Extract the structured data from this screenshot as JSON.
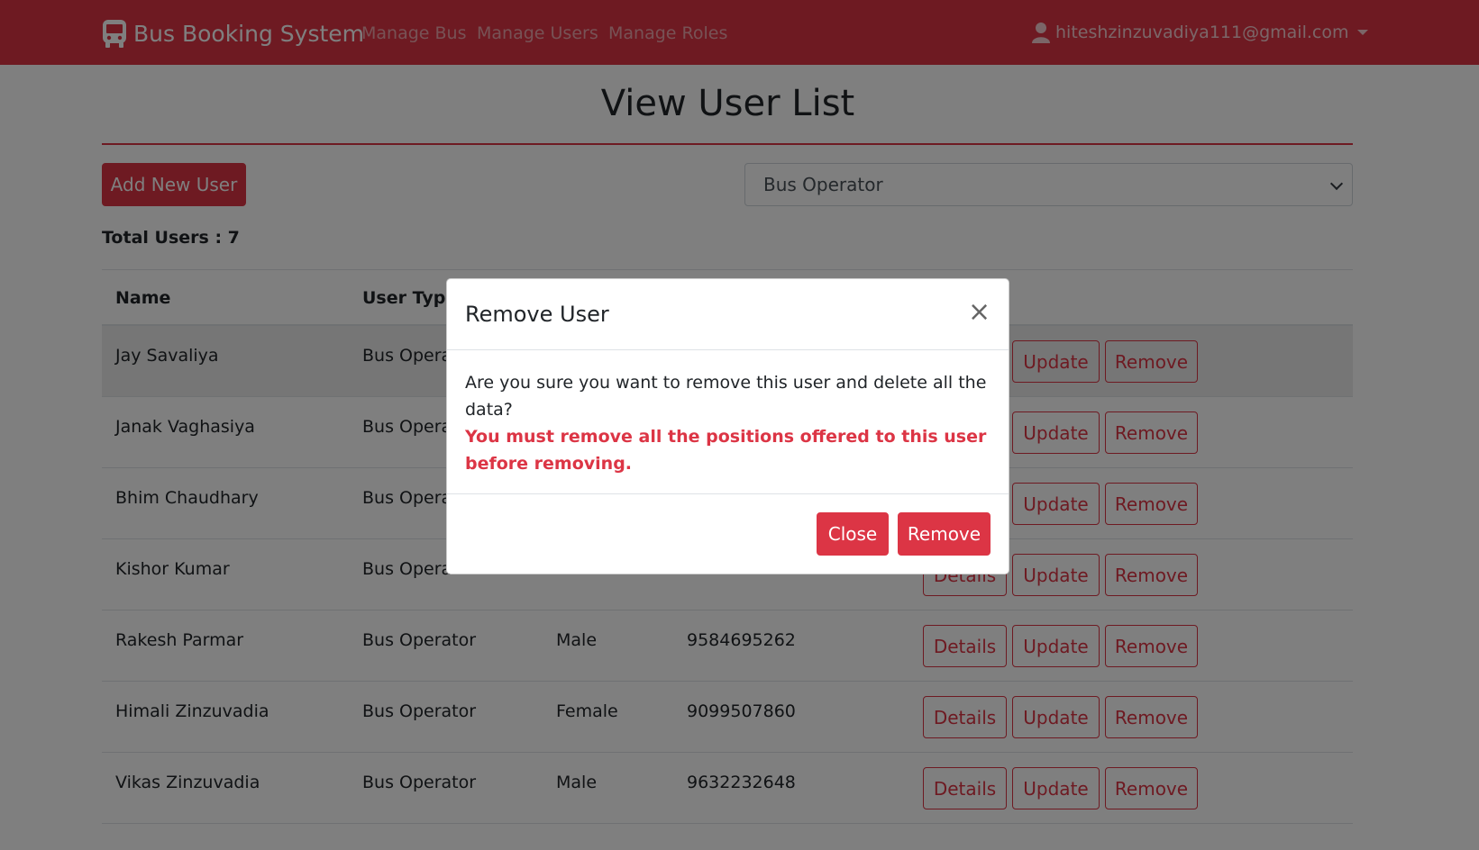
{
  "navbar": {
    "brand": "Bus Booking System",
    "links": [
      "Manage Bus",
      "Manage Users",
      "Manage Roles"
    ],
    "user_email": "hiteshzinzuvadiya111@gmail.com",
    "accent_color": "#dc3545"
  },
  "page": {
    "title": "View User List",
    "add_button": "Add New User",
    "role_select": {
      "selected": "Bus Operator"
    },
    "total_users": "Total Users : 7"
  },
  "table": {
    "headers": [
      "Name",
      "User Type"
    ],
    "rows": [
      {
        "name": "Jay Savaliya",
        "type": "Bus Operat",
        "gender": "",
        "phone": ""
      },
      {
        "name": "Janak Vaghasiya",
        "type": "Bus Operat",
        "gender": "",
        "phone": ""
      },
      {
        "name": "Bhim Chaudhary",
        "type": "Bus Operat",
        "gender": "",
        "phone": ""
      },
      {
        "name": "Kishor Kumar",
        "type": "Bus Operat",
        "gender": "",
        "phone": ""
      },
      {
        "name": "Rakesh Parmar",
        "type": "Bus Operator",
        "gender": "Male",
        "phone": "9584695262"
      },
      {
        "name": "Himali Zinzuvadia",
        "type": "Bus Operator",
        "gender": "Female",
        "phone": "9099507860"
      },
      {
        "name": "Vikas Zinzuvadia",
        "type": "Bus Operator",
        "gender": "Male",
        "phone": "9632232648"
      }
    ],
    "actions": {
      "details": "Details",
      "update": "Update",
      "remove": "Remove"
    }
  },
  "modal": {
    "title": "Remove User",
    "close_symbol": "×",
    "message": "Are you sure you want to remove this user and delete all the data?",
    "warning": "You must remove all the positions offered to this user before removing.",
    "close_button": "Close",
    "remove_button": "Remove"
  }
}
